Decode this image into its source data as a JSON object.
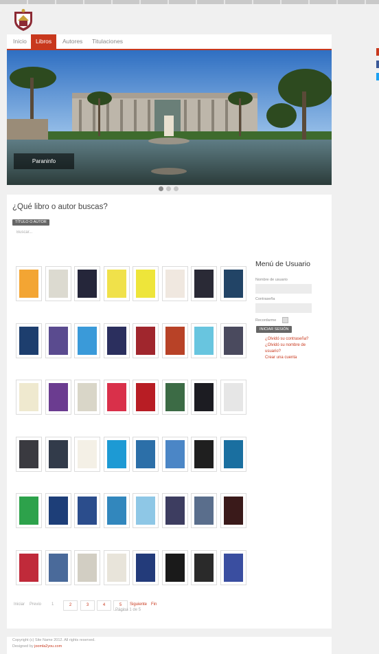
{
  "nav": {
    "items": [
      "Inicio",
      "Libros",
      "Autores",
      "Titulaciones"
    ],
    "active_index": 1
  },
  "slider": {
    "caption": "Paraninfo",
    "slides": 3,
    "active": 0
  },
  "search": {
    "heading": "¿Qué libro o autor buscas?",
    "filter_badge": "TÍTULO O AUTOR",
    "placeholder": "Buscar..."
  },
  "books": {
    "count": 48,
    "colors": [
      "#f3a533",
      "#dcdad0",
      "#25263a",
      "#f0e14a",
      "#eee53a",
      "#f0e8e0",
      "#2a2a36",
      "#224466",
      "#1d3e6e",
      "#5a4b8f",
      "#3a9ad9",
      "#2b2f5e",
      "#a0262d",
      "#b84227",
      "#68c5df",
      "#4a4a5e",
      "#efe9cf",
      "#6b3c90",
      "#d9d6c8",
      "#d9304a",
      "#b81d24",
      "#3c6b45",
      "#1c1c22",
      "#e6e6e6",
      "#3a3a40",
      "#323b4a",
      "#f4f0e6",
      "#1d9ad4",
      "#2c6fa8",
      "#4b86c6",
      "#1f1f1f",
      "#1a6fa0",
      "#2da24b",
      "#1d3e78",
      "#2b4d8c",
      "#3287bd",
      "#8ec7e6",
      "#3d3d60",
      "#5a6e8c",
      "#3a1a1a",
      "#c02a3a",
      "#4a6a9a",
      "#d2cec3",
      "#e8e4da",
      "#233b7a",
      "#1a1a1a",
      "#2a2a2a",
      "#3a4ea0"
    ]
  },
  "sidebar": {
    "title": "Menú de Usuario",
    "username_label": "Nombre de usuario",
    "password_label": "Contraseña",
    "remember_label": "Recordarme",
    "login_button": "INICIAR SESIÓN",
    "links": [
      "¿Olvidó su contraseña?",
      "¿Olvidó su nombre de",
      "usuario?",
      "Crear una cuenta"
    ]
  },
  "pagination": {
    "start": "Iniciar",
    "prev": "Previo",
    "pages": [
      "1",
      "2",
      "3",
      "4",
      "5"
    ],
    "current": "1",
    "next": "Siguiente",
    "end": "Fin",
    "info": "Página 1 de 5"
  },
  "footer": {
    "copyright": "Copyright (c) Site Name 2012. All rights reserved.",
    "designed_by": "Designed by",
    "designer": "joomla2you.com"
  },
  "colors": {
    "accent": "#c8381d",
    "background": "#f0f0f0"
  }
}
